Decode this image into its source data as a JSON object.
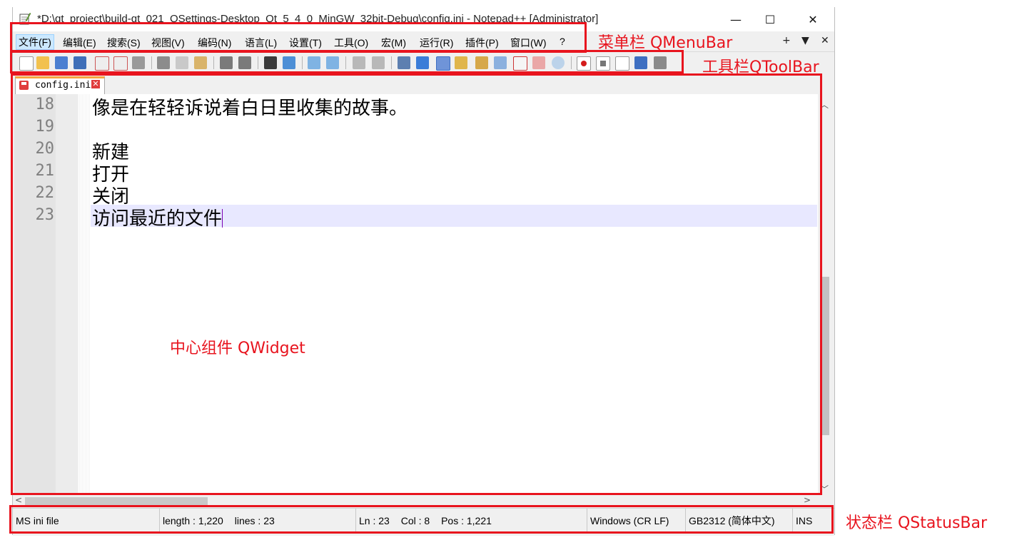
{
  "window": {
    "title": "*D:\\qt_project\\build-qt_021_QSettings-Desktop_Qt_5_4_0_MinGW_32bit-Debug\\config.ini - Notepad++ [Administrator]",
    "controls": {
      "minimize": "—",
      "maximize": "☐",
      "close": "✕"
    }
  },
  "menubar": {
    "items": [
      "文件(F)",
      "编辑(E)",
      "搜索(S)",
      "视图(V)",
      "编码(N)",
      "语言(L)",
      "设置(T)",
      "工具(O)",
      "宏(M)",
      "运行(R)",
      "插件(P)",
      "窗口(W)",
      "?"
    ],
    "mdi_controls": {
      "add": "+",
      "list": "▼",
      "close": "✕"
    }
  },
  "toolbar": {
    "icons": [
      "new-file",
      "open-file",
      "save",
      "save-all",
      "close",
      "close-all",
      "print",
      "cut",
      "copy",
      "paste",
      "undo",
      "redo",
      "find",
      "replace",
      "zoom-in",
      "zoom-out",
      "sync-vertical",
      "sync-horizontal",
      "word-wrap",
      "show-all-chars",
      "indent-guide",
      "user-defined-language",
      "document-map",
      "function-list",
      "folder-workspace",
      "monitoring",
      "record-macro",
      "stop-recording",
      "playback-macro",
      "run-macro-multiple",
      "save-macro"
    ]
  },
  "tabs": [
    {
      "label": "config.ini",
      "close": "✕"
    }
  ],
  "editor": {
    "lines": [
      {
        "number": "18",
        "text": "像是在轻轻诉说着白日里收集的故事。"
      },
      {
        "number": "19",
        "text": ""
      },
      {
        "number": "20",
        "text": "新建"
      },
      {
        "number": "21",
        "text": "打开"
      },
      {
        "number": "22",
        "text": "关闭"
      },
      {
        "number": "23",
        "text": "访问最近的文件",
        "current": true
      }
    ],
    "scroll": {
      "up": "︿",
      "down": "﹀",
      "left": "<",
      "right": ">"
    }
  },
  "statusbar": {
    "file_type": "MS ini file",
    "length": "length : 1,220",
    "lines": "lines : 23",
    "ln": "Ln : 23",
    "col": "Col : 8",
    "pos": "Pos : 1,221",
    "eol": "Windows (CR LF)",
    "encoding": "GB2312 (简体中文)",
    "mode": "INS"
  },
  "annotations": {
    "menubar": "菜单栏 QMenuBar",
    "toolbar": "工具栏QToolBar",
    "central": "中心组件 QWidget",
    "statusbar": "状态栏 QStatusBar"
  },
  "colors": {
    "annotation": "#e8141e",
    "current_line": "#e8e8ff",
    "tab_accent": "#f7a640"
  }
}
